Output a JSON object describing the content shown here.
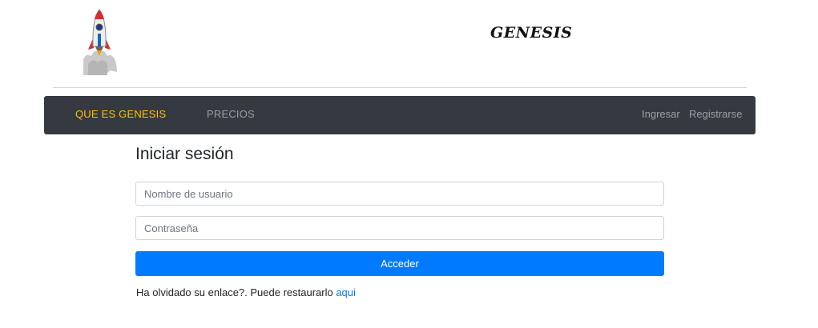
{
  "brand": {
    "title": "GENESIS",
    "logo_icon": "rocket-icon"
  },
  "navbar": {
    "items": [
      {
        "label": "QUE ES GENESIS",
        "active": true
      },
      {
        "label": "PRECIOS",
        "active": false
      }
    ],
    "right_items": [
      {
        "label": "Ingresar"
      },
      {
        "label": "Registrarse"
      }
    ],
    "colors": {
      "background": "#343a40",
      "active": "#ffc107",
      "inactive": "#9a9da0"
    }
  },
  "login": {
    "title": "Iniciar sesión",
    "username_placeholder": "Nombre de usuario",
    "username_value": "",
    "password_placeholder": "Contraseña",
    "password_value": "",
    "submit_label": "Acceder",
    "submit_color": "#007bff",
    "forgot_text": "Ha olvidado su enlace?. Puede restaurarlo ",
    "forgot_link_label": "aqui",
    "link_color": "#007bff"
  }
}
